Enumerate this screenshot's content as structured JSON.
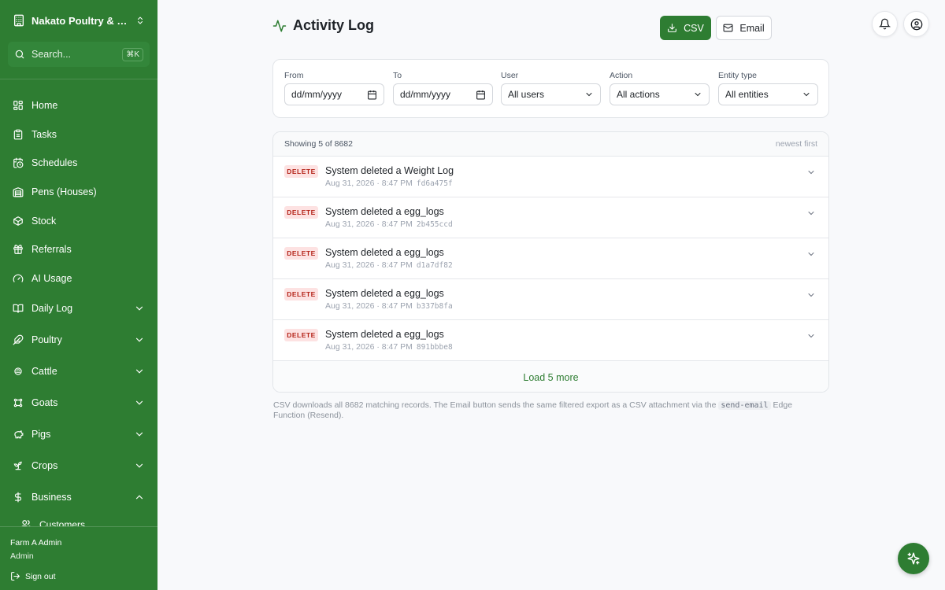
{
  "sidebar": {
    "farm_name": "Nakato Poultry & Da...",
    "search_placeholder": "Search...",
    "search_shortcut": "⌘K",
    "items": [
      {
        "label": "Home"
      },
      {
        "label": "Tasks"
      },
      {
        "label": "Schedules"
      },
      {
        "label": "Pens (Houses)"
      },
      {
        "label": "Stock"
      },
      {
        "label": "Referrals"
      },
      {
        "label": "AI Usage"
      }
    ],
    "groups": [
      {
        "label": "Daily Log",
        "expanded": false
      },
      {
        "label": "Poultry",
        "expanded": false
      },
      {
        "label": "Cattle",
        "expanded": false
      },
      {
        "label": "Goats",
        "expanded": false
      },
      {
        "label": "Pigs",
        "expanded": false
      },
      {
        "label": "Crops",
        "expanded": false
      },
      {
        "label": "Business",
        "expanded": true
      }
    ],
    "sub_item": "Customers",
    "user_name": "Farm A Admin",
    "user_role": "Admin",
    "sign_out": "Sign out"
  },
  "header": {
    "title": "Activity Log",
    "csv_label": "CSV",
    "email_label": "Email"
  },
  "filters": {
    "from_label": "From",
    "from_value": "dd/mm/yyyy",
    "to_label": "To",
    "to_value": "dd/mm/yyyy",
    "user_label": "User",
    "user_value": "All users",
    "action_label": "Action",
    "action_value": "All actions",
    "entity_label": "Entity type",
    "entity_value": "All entities"
  },
  "list": {
    "count_text": "Showing 5 of 8682",
    "sort_text": "newest first",
    "rows": [
      {
        "action": "DELETE",
        "title": "System deleted a Weight Log",
        "time": "Aug 31, 2026 · 8:47 PM",
        "hash": "fd6a475f"
      },
      {
        "action": "DELETE",
        "title": "System deleted a egg_logs",
        "time": "Aug 31, 2026 · 8:47 PM",
        "hash": "2b455ccd"
      },
      {
        "action": "DELETE",
        "title": "System deleted a egg_logs",
        "time": "Aug 31, 2026 · 8:47 PM",
        "hash": "d1a7df82"
      },
      {
        "action": "DELETE",
        "title": "System deleted a egg_logs",
        "time": "Aug 31, 2026 · 8:47 PM",
        "hash": "b337b8fa"
      },
      {
        "action": "DELETE",
        "title": "System deleted a egg_logs",
        "time": "Aug 31, 2026 · 8:47 PM",
        "hash": "891bbbe8"
      }
    ],
    "load_more": "Load 5 more"
  },
  "footnote": {
    "part1": "CSV downloads all 8682 matching records. The Email button sends the same filtered export as a CSV attachment via the",
    "code": "send-email",
    "part2": "Edge Function (Resend)."
  },
  "colors": {
    "brand": "#2e7d32",
    "delete_badge_bg": "#fde2e2",
    "delete_badge_text": "#b42318"
  },
  "icons": {
    "nav": [
      "grid-icon",
      "clipboard-icon",
      "calendar-clock-icon",
      "warehouse-icon",
      "package-icon",
      "gift-icon",
      "gauge-icon"
    ],
    "groups": [
      "book-icon",
      "feather-icon",
      "cattle-icon",
      "goat-icon",
      "pig-icon",
      "sprout-icon",
      "dollar-icon"
    ]
  }
}
